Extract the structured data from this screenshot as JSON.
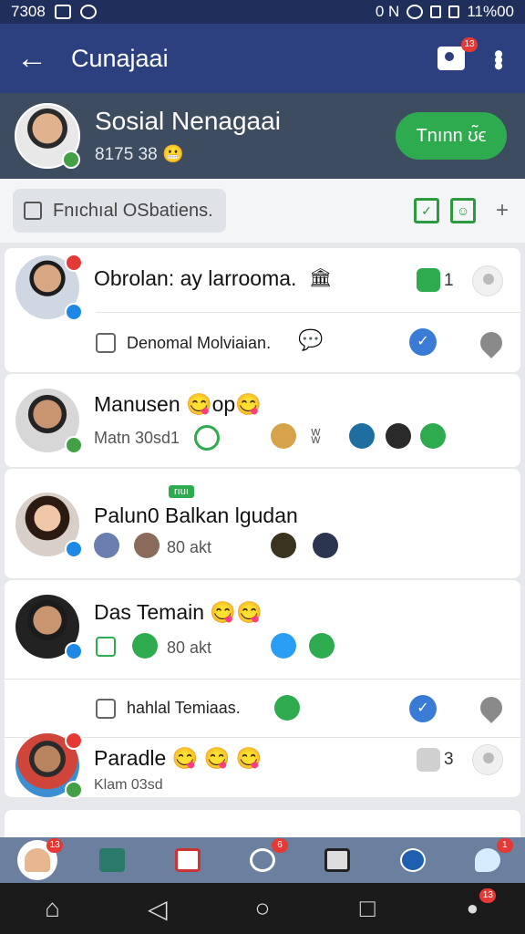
{
  "status_bar": {
    "time": "7308",
    "battery": "11%00",
    "right_glyphs": "0 N"
  },
  "app_bar": {
    "title": "Cunajaai",
    "camera_badge": "13"
  },
  "profile": {
    "name": "Sosial Nenagaai",
    "subtitle": "8175 38",
    "subtitle_emoji": "😬",
    "follow_label": "Tnınn ʊ̃ϵ"
  },
  "filter": {
    "chip_label": "Fnıchıal   OSbatiens."
  },
  "cards": [
    {
      "name": "Obrolan: ay larrooma.",
      "name_icon": "🏛",
      "count": "1",
      "sub_label": "Denomal Molviaian.",
      "sub_icon": "💬"
    },
    {
      "name": "Manusen 😋op😋",
      "sub": "Matn 30sd1",
      "extra": "ʬ"
    },
    {
      "name": "Palun0 Balkan lgudan",
      "tag": "rıuı",
      "sub": "80 akt"
    },
    {
      "name": "Das Temain 😋😋",
      "sub": "80 akt",
      "sub_label": "hahlal Temiaas."
    },
    {
      "name": "Paradle 😋 😋 😋",
      "sub": "Klam 03sd",
      "count": "3"
    }
  ],
  "app_nav": {
    "badges": [
      "13",
      "",
      "",
      "6",
      "",
      "",
      "1"
    ]
  },
  "system_nav": {
    "badge": "13"
  }
}
